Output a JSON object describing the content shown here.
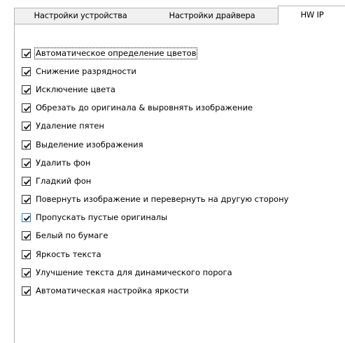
{
  "tabs": [
    {
      "label": "Настройки устройства",
      "active": false
    },
    {
      "label": "Настройки драйвера",
      "active": false
    },
    {
      "label": "HW IP",
      "active": true
    }
  ],
  "options": [
    {
      "label": "Автоматическое определение цветов",
      "checked": true
    },
    {
      "label": "Снижение разрядности",
      "checked": true
    },
    {
      "label": "Исключение цвета",
      "checked": true
    },
    {
      "label": "Обрезать до оригинала & выровнять изображение",
      "checked": true
    },
    {
      "label": "Удаление пятен",
      "checked": true
    },
    {
      "label": "Выделение изображения",
      "checked": true
    },
    {
      "label": "Удалить фон",
      "checked": true
    },
    {
      "label": "Гладкий фон",
      "checked": true
    },
    {
      "label": "Повернуть изображение и перевернуть на другую сторону",
      "checked": true
    },
    {
      "label": "Пропускать пустые оригиналы",
      "checked": true
    },
    {
      "label": "Белый по бумаге",
      "checked": true
    },
    {
      "label": "Яркость текста",
      "checked": true
    },
    {
      "label": "Улучшение текста для динамического порога",
      "checked": true
    },
    {
      "label": "Автоматическая настройка яркости",
      "checked": true
    }
  ]
}
